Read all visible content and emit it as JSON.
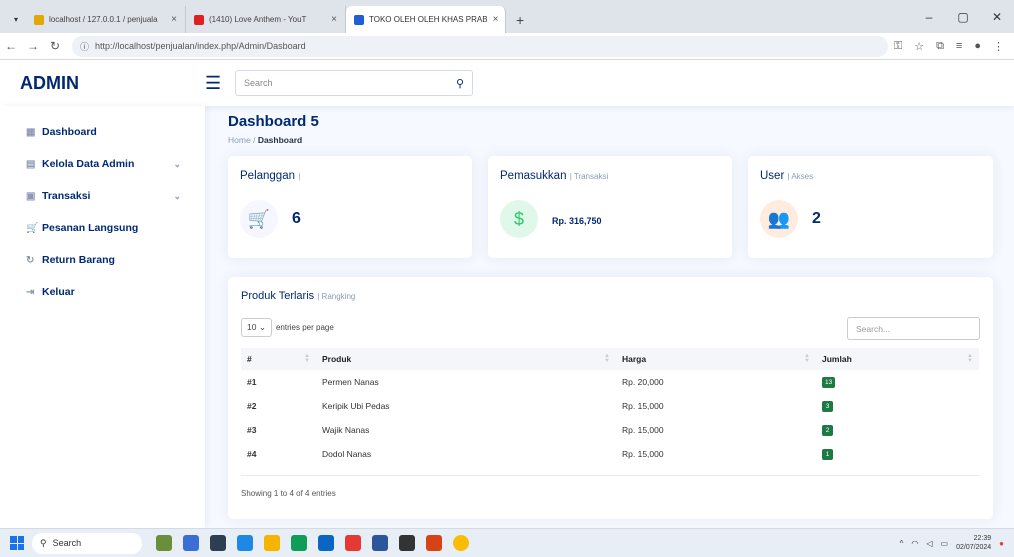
{
  "browser": {
    "tabs": [
      {
        "title": "localhost / 127.0.0.1 / penjuala",
        "active": false,
        "favicon_color": "#e0a800"
      },
      {
        "title": "(1410) Love Anthem - YouT",
        "active": false,
        "favicon_color": "#e02020"
      },
      {
        "title": "TOKO OLEH OLEH KHAS PRAB",
        "active": true,
        "favicon_color": "#1f5fd1"
      }
    ],
    "url": "http://localhost/penjualan/index.php/Admin/Dasboard",
    "minimize": "–",
    "maximize": "▢",
    "close": "✕"
  },
  "header": {
    "logo": "ADMIN",
    "search_placeholder": "Search"
  },
  "sidebar": {
    "items": [
      {
        "label": "Dashboard",
        "icon": "grid-icon",
        "glyph": "▦",
        "expandable": false
      },
      {
        "label": "Kelola Data Admin",
        "icon": "file-icon",
        "glyph": "▤",
        "expandable": true
      },
      {
        "label": "Transaksi",
        "icon": "clipboard-icon",
        "glyph": "▣",
        "expandable": true
      },
      {
        "label": "Pesanan Langsung",
        "icon": "cart-icon",
        "glyph": "🛒",
        "expandable": false
      },
      {
        "label": "Return Barang",
        "icon": "refresh-icon",
        "glyph": "↻",
        "expandable": false
      },
      {
        "label": "Keluar",
        "icon": "logout-icon",
        "glyph": "⇥",
        "expandable": false
      }
    ]
  },
  "page": {
    "title": "Dashboard 5",
    "breadcrumb_home": "Home",
    "breadcrumb_sep": "/",
    "breadcrumb_current": "Dashboard"
  },
  "cards": [
    {
      "title": "Pelanggan",
      "sub": "|",
      "value": "6",
      "icon": "cart-icon",
      "glyph": "🛒",
      "icon_bg": "#f6f6fe",
      "icon_color": "#4154f1"
    },
    {
      "title": "Pemasukkan",
      "sub": "| Transaksi",
      "value": "Rp. 316,750",
      "icon": "dollar-icon",
      "glyph": "$",
      "icon_bg": "#e0f8e9",
      "icon_color": "#2eca6a"
    },
    {
      "title": "User",
      "sub": "| Akses",
      "value": "2",
      "icon": "users-icon",
      "glyph": "👥",
      "icon_bg": "#ffecdf",
      "icon_color": "#ff771d"
    }
  ],
  "table_card": {
    "title": "Produk Terlaris",
    "sub": "| Rangking",
    "entries_value": "10",
    "entries_label": "entries per page",
    "search_placeholder": "Search...",
    "columns": [
      "#",
      "Produk",
      "Harga",
      "Jumlah"
    ],
    "rows": [
      {
        "rank": "#1",
        "produk": "Permen Nanas",
        "harga": "Rp. 20,000",
        "jumlah": "13"
      },
      {
        "rank": "#2",
        "produk": "Keripik Ubi Pedas",
        "harga": "Rp. 15,000",
        "jumlah": "3"
      },
      {
        "rank": "#3",
        "produk": "Wajik Nanas",
        "harga": "Rp. 15,000",
        "jumlah": "2"
      },
      {
        "rank": "#4",
        "produk": "Dodol Nanas",
        "harga": "Rp. 15,000",
        "jumlah": "1"
      }
    ],
    "showing": "Showing 1 to 4 of 4 entries"
  },
  "taskbar": {
    "search_label": "Search",
    "time": "22:39",
    "date": "02/07/2024"
  }
}
